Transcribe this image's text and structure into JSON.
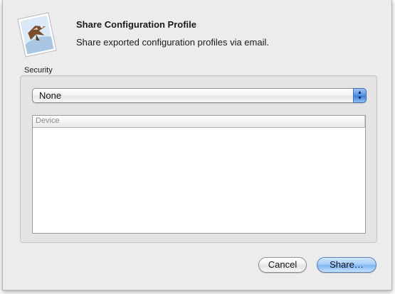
{
  "header": {
    "title": "Share Configuration Profile",
    "subtitle": "Share exported configuration profiles via email.",
    "icon": "mail-stamp-eagle-icon"
  },
  "security": {
    "label": "Security",
    "selected": "None"
  },
  "device_table": {
    "columns": [
      "Device"
    ],
    "rows": []
  },
  "buttons": {
    "cancel": "Cancel",
    "share": "Share…"
  },
  "colors": {
    "sheet_bg": "#ececec",
    "default_button": "#a5cdf8",
    "popup_arrows": "#5b97e6"
  }
}
